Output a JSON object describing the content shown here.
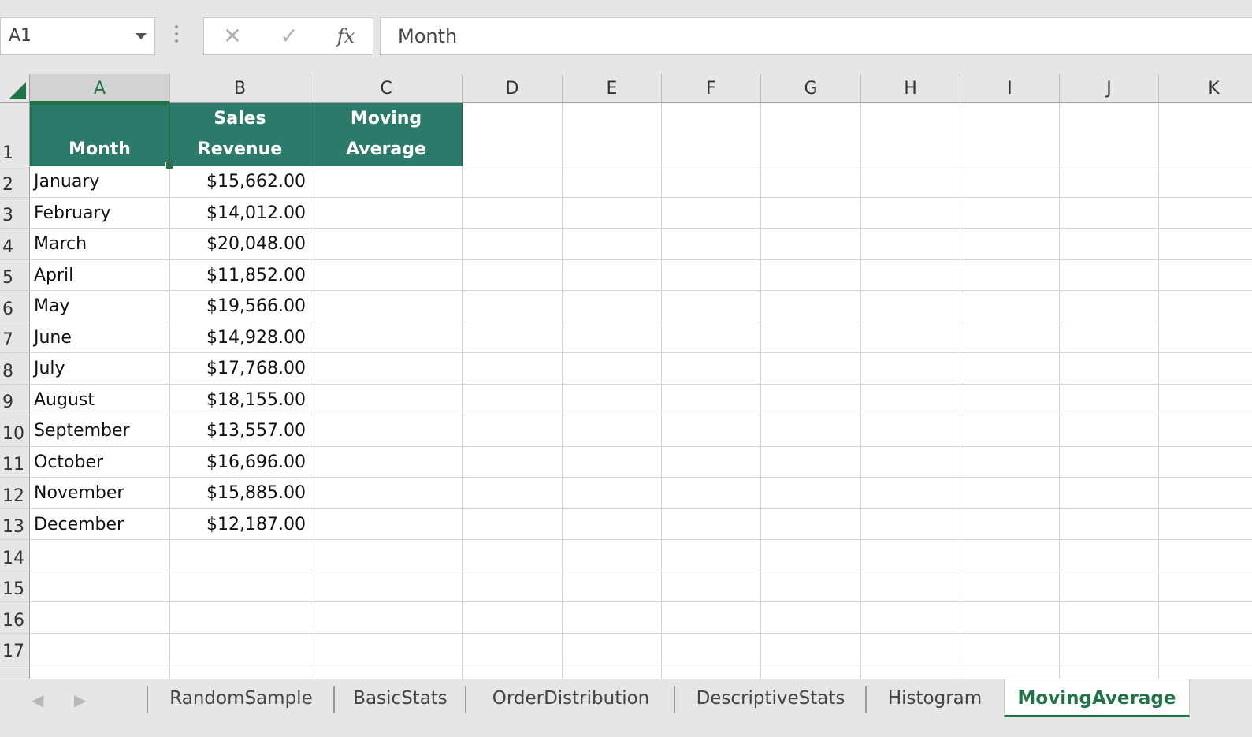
{
  "name_box": "A1",
  "formula": {
    "cancel": "✕",
    "enter": "✓",
    "fx": "fx",
    "value": "Month"
  },
  "columns": [
    "A",
    "B",
    "C",
    "D",
    "E",
    "F",
    "G",
    "H",
    "I",
    "J",
    "K"
  ],
  "rows": [
    "1",
    "2",
    "3",
    "4",
    "5",
    "6",
    "7",
    "8",
    "9",
    "10",
    "11",
    "12",
    "13",
    "14",
    "15",
    "16",
    "17"
  ],
  "headers": {
    "month": "Month",
    "sales_line1": "Sales",
    "sales_line2": "Revenue",
    "ma_line1": "Moving",
    "ma_line2": "Average"
  },
  "data": [
    {
      "month": "January",
      "sales": "$15,662.00"
    },
    {
      "month": "February",
      "sales": "$14,012.00"
    },
    {
      "month": "March",
      "sales": "$20,048.00"
    },
    {
      "month": "April",
      "sales": "$11,852.00"
    },
    {
      "month": "May",
      "sales": "$19,566.00"
    },
    {
      "month": "June",
      "sales": "$14,928.00"
    },
    {
      "month": "July",
      "sales": "$17,768.00"
    },
    {
      "month": "August",
      "sales": "$18,155.00"
    },
    {
      "month": "September",
      "sales": "$13,557.00"
    },
    {
      "month": "October",
      "sales": "$16,696.00"
    },
    {
      "month": "November",
      "sales": "$15,885.00"
    },
    {
      "month": "December",
      "sales": "$12,187.00"
    }
  ],
  "tabs": [
    "RandomSample",
    "BasicStats",
    "OrderDistribution",
    "DescriptiveStats",
    "Histogram",
    "MovingAverage"
  ],
  "active_tab": "MovingAverage",
  "colors": {
    "accent": "#217346",
    "header_fill": "#2b7a6a"
  }
}
